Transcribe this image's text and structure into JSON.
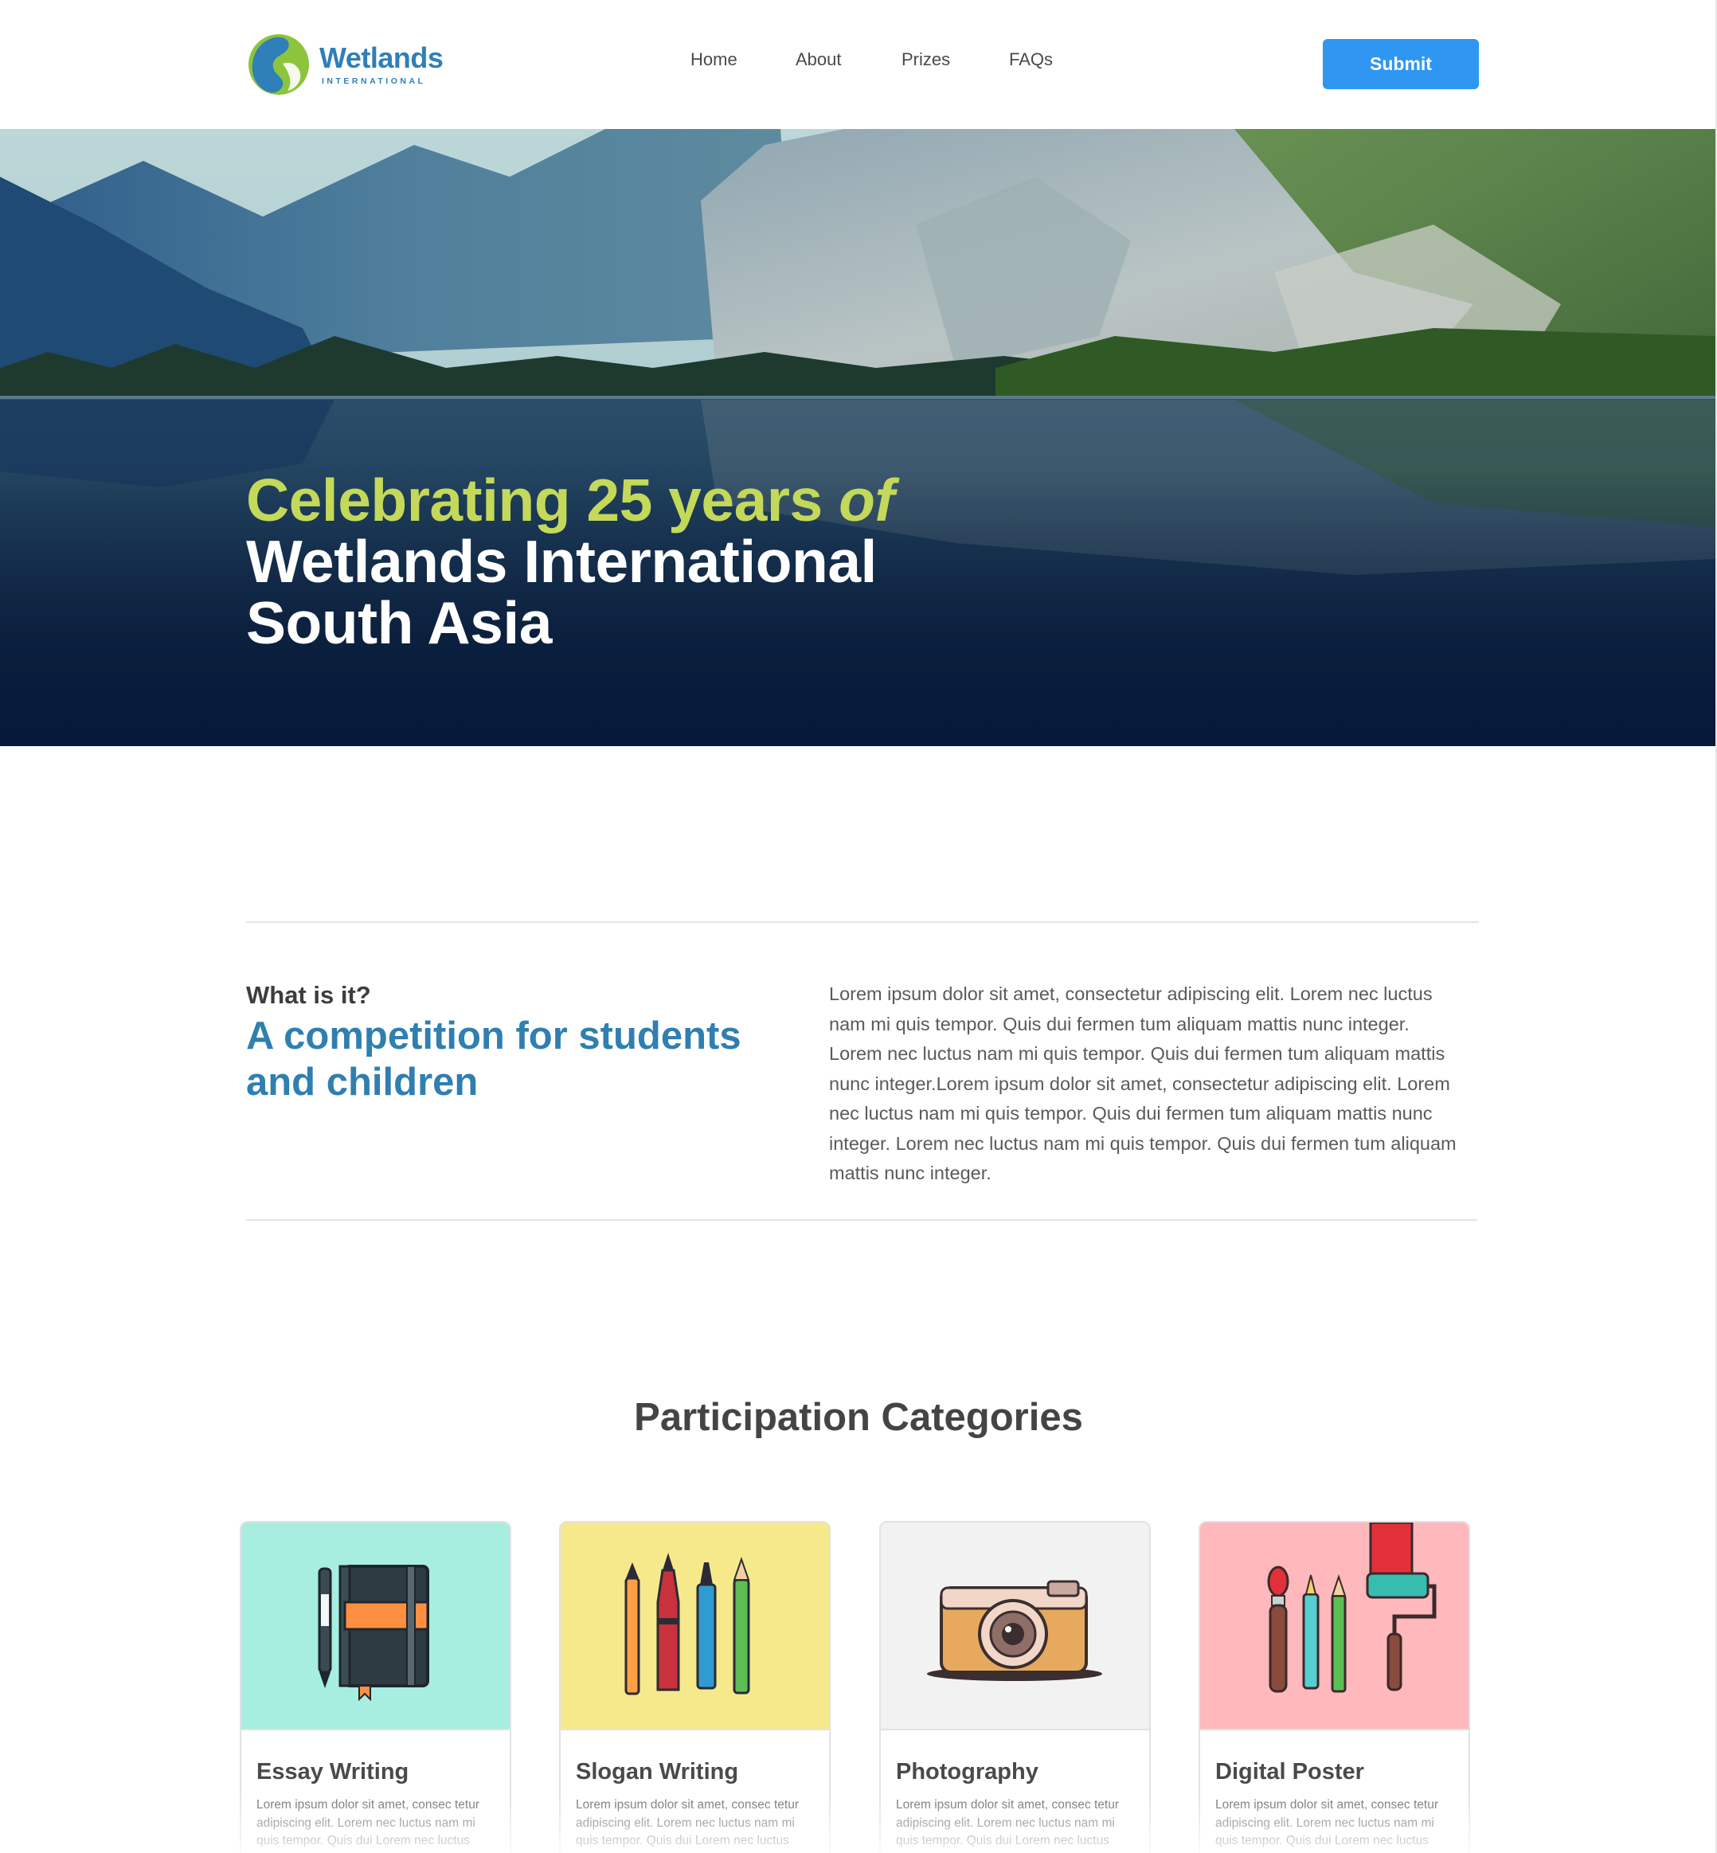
{
  "brand": {
    "name": "Wetlands",
    "tagline": "INTERNATIONAL",
    "colors": {
      "blue": "#2f7fb8",
      "green": "#8cc43c",
      "accent": "#2f96f2",
      "highlight": "#c4d85a"
    }
  },
  "nav": {
    "items": [
      {
        "label": "Home"
      },
      {
        "label": "About"
      },
      {
        "label": "Prizes"
      },
      {
        "label": "FAQs"
      }
    ],
    "submit_label": "Submit"
  },
  "hero": {
    "line1_main": "Celebrating 25 years",
    "line1_italic": "of",
    "line2": "Wetlands International",
    "line3": "South Asia",
    "image": "mountain-lake-photo"
  },
  "about": {
    "kicker": "What is it?",
    "heading": "A competition for students and children",
    "body": "Lorem ipsum dolor sit amet, consectetur adipiscing elit. Lorem nec luctus nam mi quis tempor. Quis dui fermen tum aliquam mattis nunc integer. Lorem nec luctus nam mi quis tempor. Quis dui fermen tum aliquam mattis nunc integer.Lorem ipsum dolor sit amet, consectetur adipiscing elit. Lorem nec luctus nam mi quis tempor. Quis dui fermen tum aliquam mattis nunc integer. Lorem nec luctus nam mi quis tempor. Quis dui fermen tum aliquam mattis nunc integer."
  },
  "categories": {
    "title": "Participation Categories",
    "items": [
      {
        "title": "Essay Writing",
        "icon": "notebook-pen-icon",
        "bg": "#a7ede0",
        "desc": "Lorem ipsum dolor sit amet, consec tetur adipiscing elit. Lorem nec luctus nam mi quis tempor. Quis dui Lorem nec luctus nam mi quis tempor. Quis dui"
      },
      {
        "title": "Slogan Writing",
        "icon": "pens-icon",
        "bg": "#f6e98c",
        "desc": "Lorem ipsum dolor sit amet, consec tetur adipiscing elit. Lorem nec luctus nam mi quis tempor. Quis dui Lorem nec luctus nam mi quis tempor. Quis dui"
      },
      {
        "title": "Photography",
        "icon": "camera-icon",
        "bg": "#f2f2f2",
        "desc": "Lorem ipsum dolor sit amet, consec tetur adipiscing elit. Lorem nec luctus nam mi quis tempor. Quis dui Lorem nec luctus nam mi quis tempor. Quis dui"
      },
      {
        "title": "Digital Poster",
        "icon": "paint-tools-icon",
        "bg": "#ffb8bc",
        "desc": "Lorem ipsum dolor sit amet, consec tetur adipiscing elit. Lorem nec luctus nam mi quis tempor. Quis dui Lorem nec luctus nam mi quis tempor. Quis dui"
      }
    ]
  }
}
